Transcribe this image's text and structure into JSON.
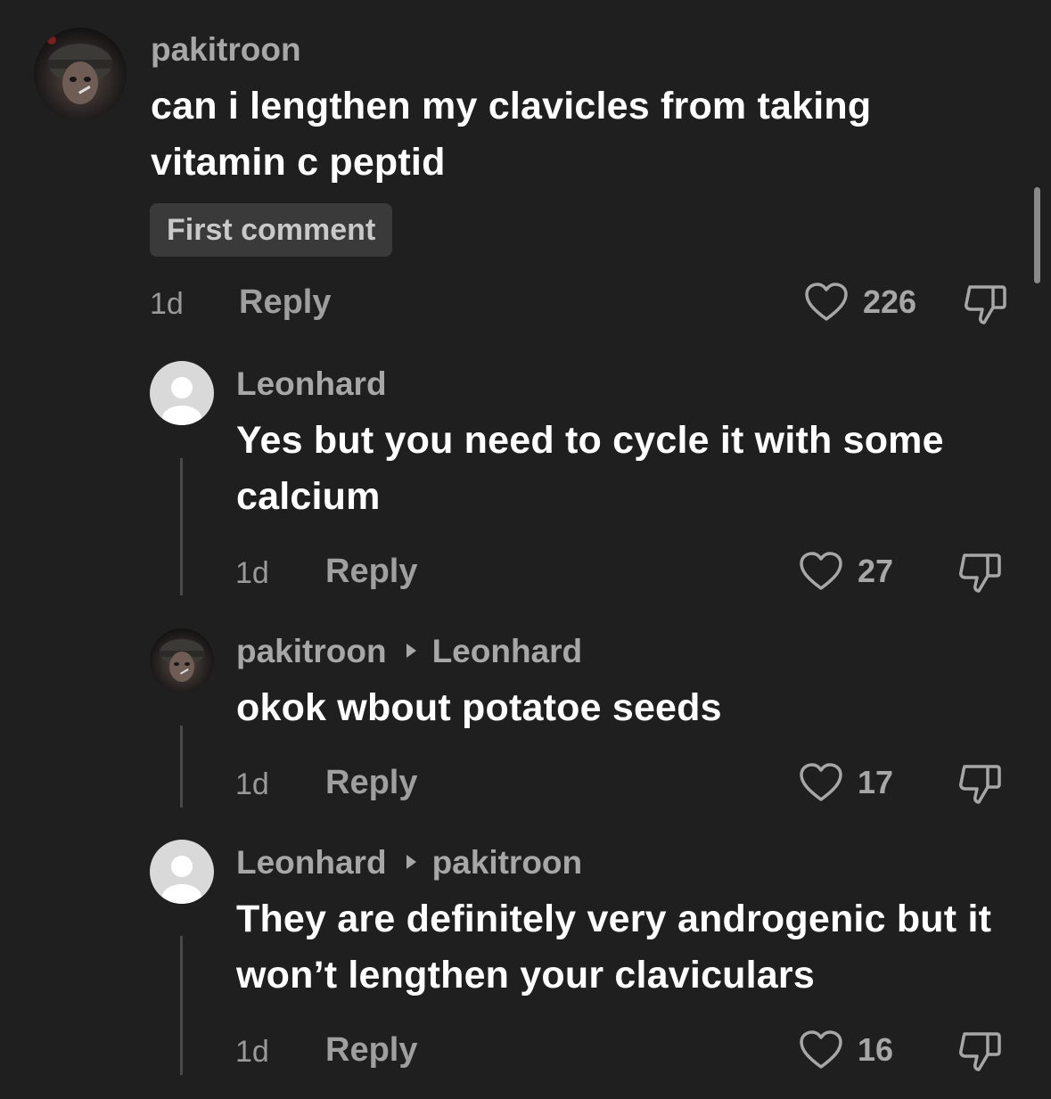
{
  "comments": [
    {
      "username": "pakitroon",
      "reply_to": null,
      "text": "can i lengthen my clavicles from taking vitamin c peptid",
      "badge": "First comment",
      "time": "1d",
      "reply_label": "Reply",
      "likes": "226",
      "avatar": "photo"
    },
    {
      "username": "Leonhard",
      "reply_to": null,
      "text": "Yes but you need to cycle it with some calcium",
      "time": "1d",
      "reply_label": "Reply",
      "likes": "27",
      "avatar": "default"
    },
    {
      "username": "pakitroon",
      "reply_to": "Leonhard",
      "text": "okok wbout potatoe seeds",
      "time": "1d",
      "reply_label": "Reply",
      "likes": "17",
      "avatar": "photo"
    },
    {
      "username": "Leonhard",
      "reply_to": "pakitroon",
      "text": "They are definitely very androgenic but it won’t lengthen your claviculars",
      "time": "1d",
      "reply_label": "Reply",
      "likes": "16",
      "avatar": "default"
    }
  ],
  "icons": {
    "like": "heart-outline-icon",
    "dislike": "thumbs-down-icon",
    "reply_arrow": "caret-right-icon",
    "default_avatar": "user-silhouette-icon"
  },
  "colors": {
    "background": "#1f1f1f",
    "username": "#a7a7a7",
    "text": "#ffffff",
    "meta": "#9a9a9a",
    "badge_bg": "#3a3a3a"
  }
}
